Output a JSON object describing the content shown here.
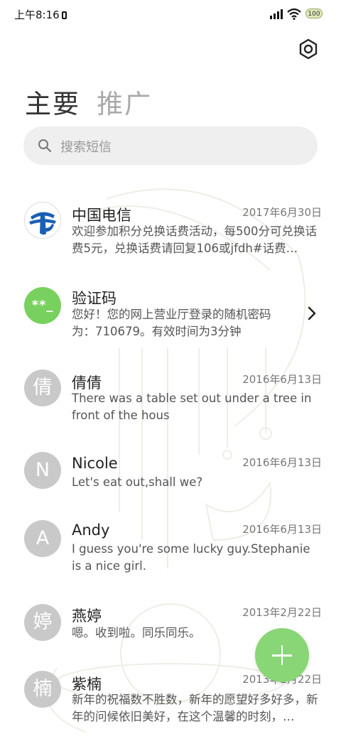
{
  "status_bar": {
    "time": "上午8:16",
    "battery": "100"
  },
  "tabs": [
    {
      "label": "主要",
      "active": true
    },
    {
      "label": "推广",
      "active": false
    }
  ],
  "search": {
    "placeholder": "搜索短信"
  },
  "messages": [
    {
      "avatar": "",
      "avatar_kind": "china-telecom-logo",
      "name": "中国电信",
      "date": "2017年6月30日",
      "preview": "欢迎参加积分兑换话费活动，每500分可兑换话费5元，兑换话费请回复106或jfdh#话费…"
    },
    {
      "avatar": "**_",
      "avatar_kind": "verification-code",
      "name": "验证码",
      "date": "",
      "preview": "您好！您的网上营业厅登录的随机密码为：710679。有效时间为3分钟"
    },
    {
      "avatar": "倩",
      "name": "倩倩",
      "date": "2016年6月13日",
      "preview": "There was a table set out under a tree in front of the hous"
    },
    {
      "avatar": "N",
      "name": "Nicole",
      "date": "2016年6月13日",
      "preview": "Let's eat out,shall we?"
    },
    {
      "avatar": "A",
      "name": "Andy",
      "date": "2016年6月13日",
      "preview": "I guess you're some lucky guy.Stephanie is a nice girl."
    },
    {
      "avatar": "婷",
      "name": "燕婷",
      "date": "2013年2月22日",
      "preview": "嗯。收到啦。同乐同乐。"
    },
    {
      "avatar": "楠",
      "name": "紫楠",
      "date": "2013年2月22日",
      "preview": "新年的祝福数不胜数，新年的愿望好多好多，新年的问候依旧美好，在这个温馨的时刻，…"
    }
  ],
  "colors": {
    "accent_green": "#88d675",
    "avatar_gray": "#c9c9c9",
    "verification_green": "#78d15f",
    "telecom_blue": "#1a5fb4"
  }
}
